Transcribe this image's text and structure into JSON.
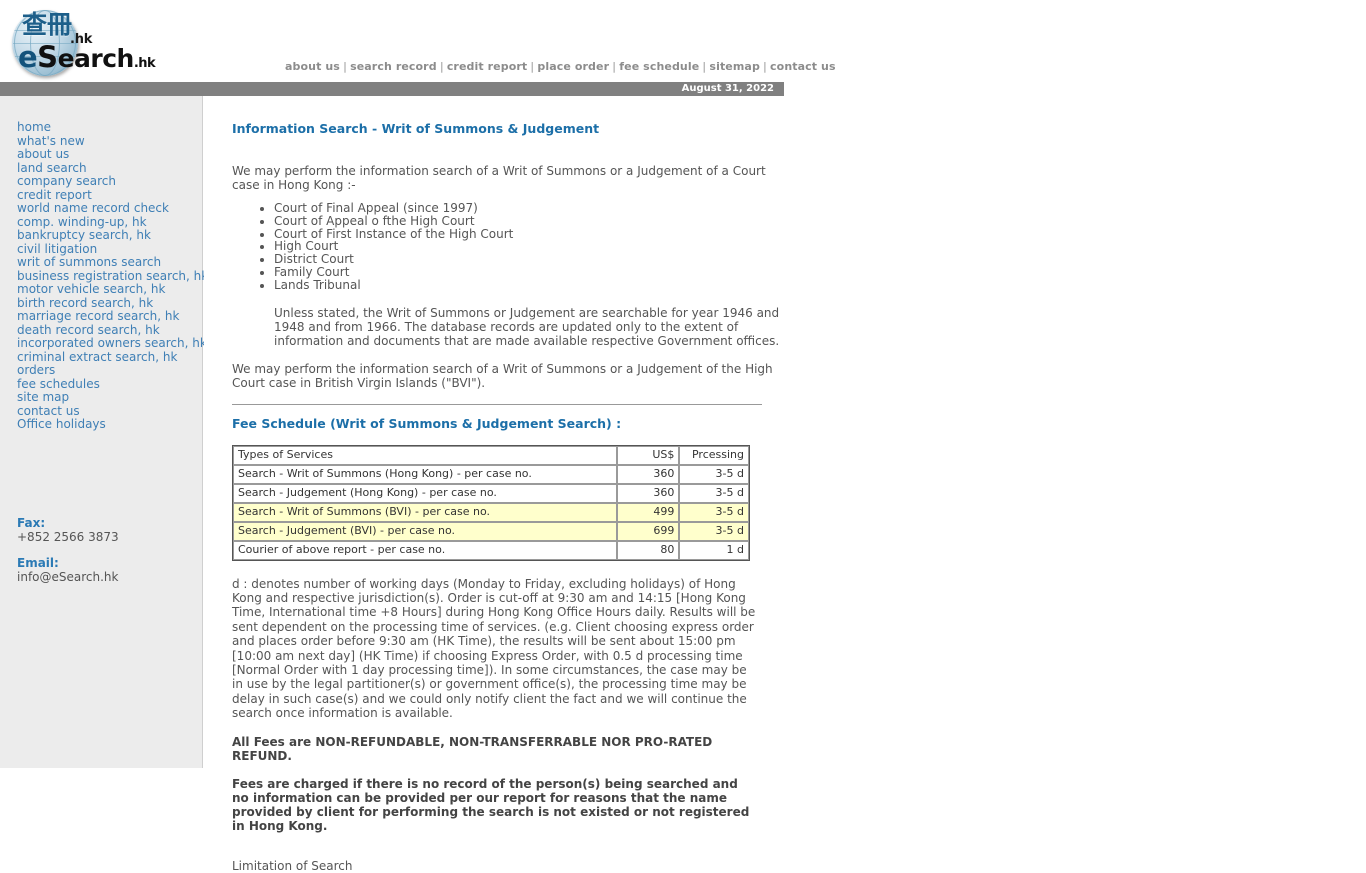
{
  "header": {
    "logo": {
      "cjk": "查冊",
      "hk_suffix": ".hk",
      "wordmark_e": "e",
      "wordmark_s": "S",
      "wordmark_rest": "earch",
      "wordmark_suffix": ".hk"
    },
    "nav": [
      {
        "label": "about us"
      },
      {
        "label": "search record"
      },
      {
        "label": "credit report"
      },
      {
        "label": "place order"
      },
      {
        "label": "fee schedule"
      },
      {
        "label": "sitemap"
      },
      {
        "label": "contact us"
      }
    ],
    "separator": "|",
    "date": "August 31, 2022"
  },
  "sidebar": {
    "items": [
      {
        "label": "home"
      },
      {
        "label": "what's new"
      },
      {
        "label": "about us"
      },
      {
        "label": "land search"
      },
      {
        "label": "company search"
      },
      {
        "label": "credit report"
      },
      {
        "label": "world name record check"
      },
      {
        "label": "comp. winding-up, hk"
      },
      {
        "label": "bankruptcy search, hk"
      },
      {
        "label": "civil litigation"
      },
      {
        "label": "writ of summons search"
      },
      {
        "label": "business registration search, hk"
      },
      {
        "label": "motor vehicle search, hk"
      },
      {
        "label": "birth record search, hk"
      },
      {
        "label": "marriage record search, hk"
      },
      {
        "label": "death record search, hk"
      },
      {
        "label": "incorporated owners search, hk"
      },
      {
        "label": "criminal extract search, hk"
      },
      {
        "label": "orders"
      },
      {
        "label": "fee schedules"
      },
      {
        "label": "site map"
      },
      {
        "label": "contact us"
      },
      {
        "label": "Office holidays"
      }
    ],
    "contact": {
      "fax_label": "Fax:",
      "fax_value": "+852 2566 3873",
      "email_label": "Email:",
      "email_value": "info@eSearch.hk"
    }
  },
  "main": {
    "title": "Information Search - Writ of Summons & Judgement",
    "intro": "We may perform the information search of a Writ of Summons or a Judgement of a Court case in Hong Kong :-",
    "courts": [
      {
        "label": "Court of Final Appeal (since 1997)"
      },
      {
        "label": "Court of Appeal o fthe High Court"
      },
      {
        "label": "Court of First Instance of the High Court"
      },
      {
        "label": "High Court"
      },
      {
        "label": "District Court"
      },
      {
        "label": "Family Court"
      },
      {
        "label": "Lands Tribunal"
      }
    ],
    "note_years": "Unless stated, the Writ of Summons or Judgement are searchable for year 1946 and 1948 and from 1966. The database records are updated only to the extent of information and documents that are made available respective Government offices.",
    "bvi_paragraph": "We may perform the information search of a Writ of Summons or a Judgement of the High Court case in British Virgin Islands (\"BVI\").",
    "fee_title": "Fee Schedule (Writ of Summons & Judgement Search) :",
    "fee_table": {
      "headers": {
        "service": "Types of Services",
        "price": "US$",
        "processing": "Prcessing"
      },
      "rows": [
        {
          "service": "Search - Writ of Summons (Hong Kong) - per case no.",
          "price": "360",
          "processing": "3-5 d",
          "highlight": false
        },
        {
          "service": "Search - Judgement (Hong Kong) - per case no.",
          "price": "360",
          "processing": "3-5 d",
          "highlight": false
        },
        {
          "service": "Search - Writ of Summons (BVI) - per case no.",
          "price": "499",
          "processing": "3-5 d",
          "highlight": true
        },
        {
          "service": "Search - Judgement (BVI) - per case no.",
          "price": "699",
          "processing": "3-5 d",
          "highlight": true
        },
        {
          "service": "Courier of above report - per case no.",
          "price": "80",
          "processing": "1 d",
          "highlight": false
        }
      ]
    },
    "processing_note": "d : denotes number of working days (Monday to Friday, excluding holidays) of Hong Kong and respective jurisdiction(s). Order is cut-off at 9:30 am and 14:15 [Hong Kong Time, International time +8 Hours] during Hong Kong Office Hours daily. Results will be sent dependent on the processing time of services. (e.g. Client choosing express order and places order before 9:30 am (HK Time), the results will be sent about 15:00 pm [10:00 am next day] (HK Time) if choosing Express Order, with 0.5 d processing time [Normal Order with 1 day processing time]). In some circumstances, the case may be in use by the legal partitioner(s) or government office(s), the processing time may be delay in such case(s) and we could only notify client the fact and we will continue the search once information is available.",
    "fees_nonrefundable": "All Fees are NON-REFUNDABLE, NON-TRANSFERRABLE NOR PRO-RATED REFUND.",
    "fees_charged": "Fees are charged if there is no record of the person(s) being searched and no information can be provided per our report for reasons that the name provided by client for performing the search is not existed or not registered in Hong Kong.",
    "limitation_heading": "Limitation of Search"
  },
  "colors": {
    "link": "#3f7fb5",
    "heading": "#1c6fa8",
    "datebar_bg": "#808080",
    "sidebar_bg": "#ececec",
    "highlight_row": "#ffffcc"
  }
}
